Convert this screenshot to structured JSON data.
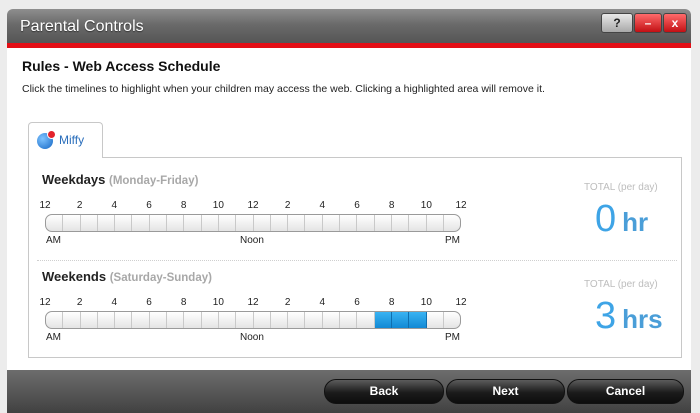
{
  "window": {
    "title": "Parental Controls",
    "help_label": "?",
    "minimize_label": "–",
    "close_label": "x"
  },
  "header": {
    "title": "Rules - Web Access Schedule",
    "instructions": "Click the timelines to highlight when your children may access the web. Clicking a highlighted area will remove it."
  },
  "tabs": [
    {
      "label": "Miffy",
      "icon": "user-globe-icon"
    }
  ],
  "ticks": [
    "12",
    "2",
    "4",
    "6",
    "8",
    "10",
    "12",
    "2",
    "4",
    "6",
    "8",
    "10",
    "12"
  ],
  "period_labels": {
    "am": "AM",
    "noon": "Noon",
    "pm": "PM"
  },
  "schedules": [
    {
      "name": "Weekdays",
      "range": "(Monday-Friday)",
      "total_label": "TOTAL (per day)",
      "total_value": "0",
      "total_unit": "hr",
      "active_hours": []
    },
    {
      "name": "Weekends",
      "range": "(Saturday-Sunday)",
      "total_label": "TOTAL (per day)",
      "total_value": "3",
      "total_unit": "hrs",
      "active_hours": [
        19,
        20,
        21
      ]
    }
  ],
  "buttons": {
    "back": "Back",
    "next": "Next",
    "cancel": "Cancel"
  },
  "colors": {
    "accent_red": "#e30e15",
    "highlight_blue": "#1289d4",
    "total_blue": "#3ea4e6"
  }
}
